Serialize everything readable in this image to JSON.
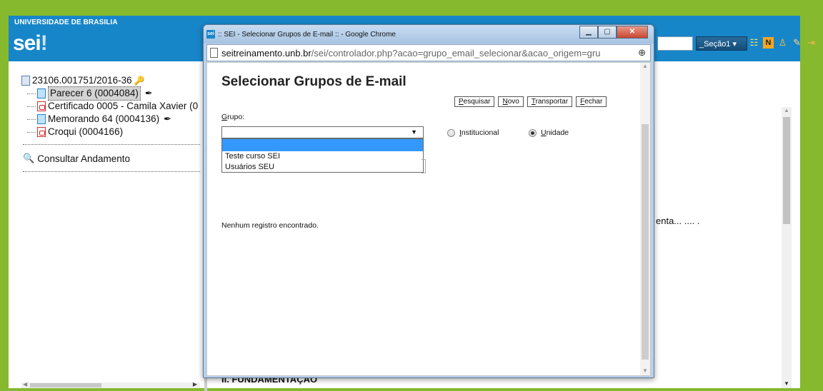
{
  "header": {
    "university": "UNIVERSIDADE DE BRASILIA",
    "logo_main": "sei",
    "logo_dot": "!",
    "secao_select": "_Seção1 ▾"
  },
  "tree": {
    "process": "23106.001751/2016-36",
    "items": [
      {
        "label": "Parecer 6 (0004084)",
        "type": "doc",
        "selected": true
      },
      {
        "label": "Certificado 0005 - Camila Xavier (0",
        "type": "pdf"
      },
      {
        "label": "Memorando 64 (0004136)",
        "type": "doc"
      },
      {
        "label": "Croqui (0004166)",
        "type": "pdf"
      }
    ],
    "consultar": "Consultar Andamento"
  },
  "document": {
    "text_fragment": "enta... .... .",
    "heading": "II. FUNDAMENTAÇÃO"
  },
  "popup": {
    "title": ":: SEI - Selecionar Grupos de E-mail :: - Google Chrome",
    "favicon": "sei",
    "url_host": "seitreinamento.unb.br",
    "url_rest": "/sei/controlador.php?acao=grupo_email_selecionar&acao_origem=gru",
    "page_title": "Selecionar Grupos de E-mail",
    "buttons": {
      "pesquisar_first": "P",
      "pesquisar_rest": "esquisar",
      "novo_first": "N",
      "novo_rest": "ovo",
      "transportar_first": "T",
      "transportar_rest": "ransportar",
      "fechar_first": "F",
      "fechar_rest": "echar"
    },
    "grupo_label_first": "G",
    "grupo_label_rest": "rupo:",
    "select_value": "",
    "dropdown_options": [
      "",
      "Teste curso SEI",
      "Usuários SEU"
    ],
    "radio_institucional_first": "I",
    "radio_institucional_rest": "nstitucional",
    "radio_unidade_first": "U",
    "radio_unidade_rest": "nidade",
    "radio_selected": "unidade",
    "empty_message": "Nenhum registro encontrado."
  },
  "colors": {
    "frame_green": "#86b92e",
    "header_blue": "#1786c9",
    "dropdown_highlight": "#3399ff"
  }
}
